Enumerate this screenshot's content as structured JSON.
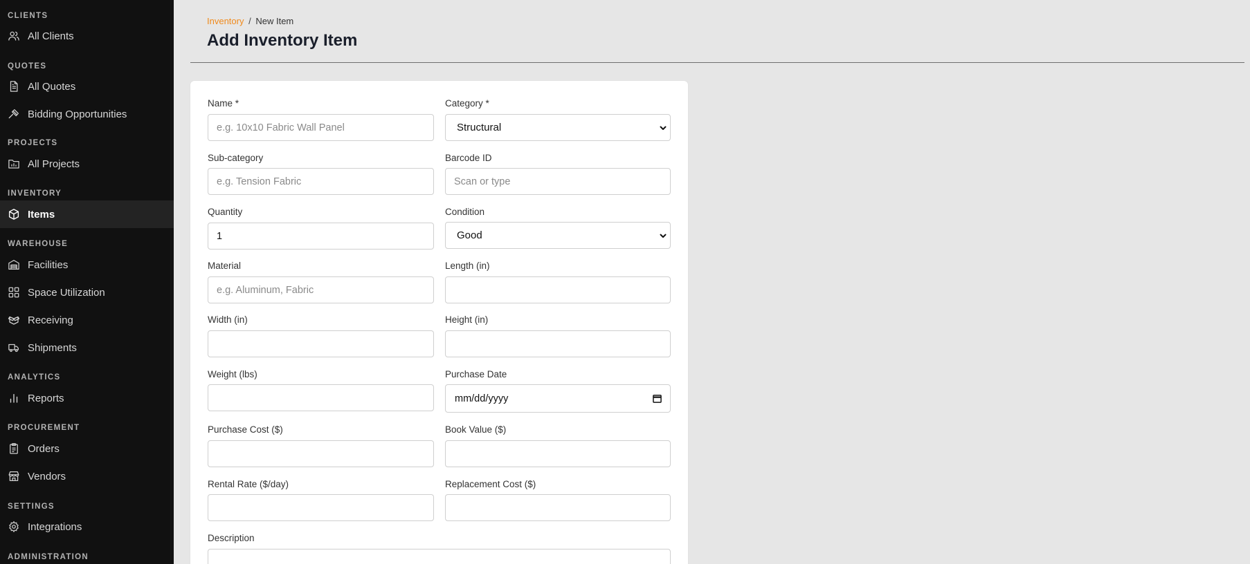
{
  "sidebar": {
    "sections": {
      "clients": "CLIENTS",
      "quotes": "QUOTES",
      "projects": "PROJECTS",
      "inventory": "INVENTORY",
      "warehouse": "WAREHOUSE",
      "analytics": "ANALYTICS",
      "procurement": "PROCUREMENT",
      "settings": "SETTINGS",
      "administration": "ADMINISTRATION"
    },
    "items": {
      "all_clients": "All Clients",
      "all_quotes": "All Quotes",
      "bidding": "Bidding Opportunities",
      "all_projects": "All Projects",
      "items": "Items",
      "facilities": "Facilities",
      "space": "Space Utilization",
      "receiving": "Receiving",
      "shipments": "Shipments",
      "reports": "Reports",
      "orders": "Orders",
      "vendors": "Vendors",
      "integrations": "Integrations"
    }
  },
  "header": {
    "breadcrumb_link": "Inventory",
    "breadcrumb_sep": "/",
    "breadcrumb_current": "New Item",
    "title": "Add Inventory Item"
  },
  "form": {
    "name": {
      "label": "Name *",
      "placeholder": "e.g. 10x10 Fabric Wall Panel",
      "value": ""
    },
    "category": {
      "label": "Category *",
      "value": "Structural"
    },
    "subcategory": {
      "label": "Sub-category",
      "placeholder": "e.g. Tension Fabric",
      "value": ""
    },
    "barcode": {
      "label": "Barcode ID",
      "placeholder": "Scan or type",
      "value": ""
    },
    "quantity": {
      "label": "Quantity",
      "placeholder": "",
      "value": "1"
    },
    "condition": {
      "label": "Condition",
      "value": "Good"
    },
    "material": {
      "label": "Material",
      "placeholder": "e.g. Aluminum, Fabric",
      "value": ""
    },
    "length": {
      "label": "Length (in)",
      "placeholder": "",
      "value": ""
    },
    "width": {
      "label": "Width (in)",
      "placeholder": "",
      "value": ""
    },
    "height": {
      "label": "Height (in)",
      "placeholder": "",
      "value": ""
    },
    "weight": {
      "label": "Weight (lbs)",
      "placeholder": "",
      "value": ""
    },
    "purchase_date": {
      "label": "Purchase Date",
      "value": "mm/dd/yyyy"
    },
    "purchase_cost": {
      "label": "Purchase Cost ($)",
      "placeholder": "",
      "value": ""
    },
    "book_value": {
      "label": "Book Value ($)",
      "placeholder": "",
      "value": ""
    },
    "rental_rate": {
      "label": "Rental Rate ($/day)",
      "placeholder": "",
      "value": ""
    },
    "replacement_cost": {
      "label": "Replacement Cost ($)",
      "placeholder": "",
      "value": ""
    },
    "description": {
      "label": "Description",
      "placeholder": "",
      "value": ""
    }
  },
  "colors": {
    "sidebar_bg": "#111111",
    "active_item_bg": "#232323",
    "accent": "#f08a1c",
    "page_bg": "#e6e6e6"
  }
}
